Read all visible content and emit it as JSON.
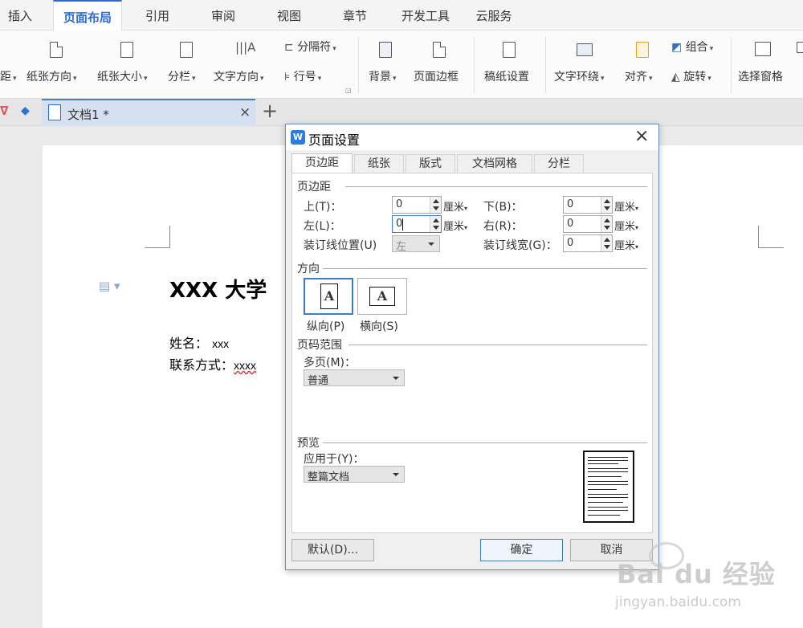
{
  "menubar": {
    "tabs": [
      "插入",
      "页面布局",
      "引用",
      "审阅",
      "视图",
      "章节",
      "开发工具",
      "云服务"
    ],
    "active": "页面布局"
  },
  "ribbon": {
    "margin_cut": "距",
    "orientation": "纸张方向",
    "size": "纸张大小",
    "columns": "分栏",
    "text_direction": "文字方向",
    "breaks": "分隔符",
    "line_numbers": "行号",
    "background": "背景",
    "page_border": "页面边框",
    "manuscript": "稿纸设置",
    "text_wrap": "文字环绕",
    "align": "对齐",
    "group": "组合",
    "rotate": "旋转",
    "selection_pane": "选择窗格"
  },
  "doctab": {
    "title": "文档1 *",
    "close": "×",
    "new": "+"
  },
  "document": {
    "heading": "XXX 大学",
    "name_label": "姓名：",
    "name_value": "xxx",
    "contact_label": "联系方式：",
    "contact_value": "xxxx"
  },
  "dialog": {
    "title": "页面设置",
    "close": "×",
    "tabs": [
      "页边距",
      "纸张",
      "版式",
      "文档网格",
      "分栏"
    ],
    "active_tab": "页边距",
    "margins_section": "页边距",
    "top_label": "上(T)：",
    "top_value": "0",
    "bottom_label": "下(B)：",
    "bottom_value": "0",
    "left_label": "左(L)：",
    "left_value": "0",
    "right_label": "右(R)：",
    "right_value": "0",
    "unit": "厘米",
    "gutter_pos_label": "装订线位置(U)",
    "gutter_pos_value": "左",
    "gutter_width_label": "装订线宽(G)：",
    "gutter_width_value": "0",
    "orientation_section": "方向",
    "portrait": "纵向(P)",
    "landscape": "横向(S)",
    "orientation_letter": "A",
    "pages_section": "页码范围",
    "multi_pages_label": "多页(M)：",
    "multi_pages_value": "普通",
    "preview_section": "预览",
    "apply_label": "应用于(Y)：",
    "apply_value": "整篇文档",
    "default_button": "默认(D)...",
    "ok_button": "确定",
    "cancel_button": "取消"
  },
  "watermark": {
    "logo": "Bai du 经验",
    "url": "jingyan.baidu.com"
  },
  "colors": {
    "accent": "#2b6bd6",
    "dialog_border": "#6d8fbd",
    "selected_border": "#3d7ad8"
  }
}
